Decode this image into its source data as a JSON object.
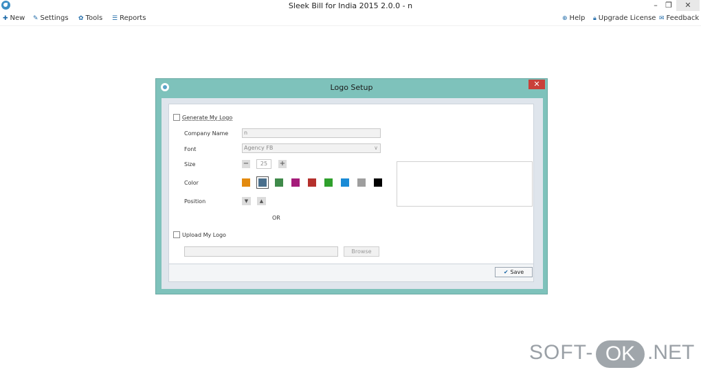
{
  "window": {
    "title": "Sleek Bill for India 2015 2.0.0 - n",
    "minimize_glyph": "–",
    "restore_glyph": "❐",
    "close_glyph": "✕"
  },
  "menubar": {
    "new": "New",
    "settings": "Settings",
    "tools": "Tools",
    "reports": "Reports",
    "help": "Help",
    "upgrade": "Upgrade License",
    "feedback": "Feedback",
    "icons": {
      "new": "plus-icon",
      "settings": "wrench-icon",
      "tools": "gear-icon",
      "reports": "list-icon",
      "help": "plus-circle-icon",
      "upgrade": "lock-icon",
      "feedback": "envelope-icon"
    }
  },
  "dialog": {
    "title": "Logo Setup",
    "close_glyph": "✕",
    "generate_label": "Generate My Logo",
    "company_name_label": "Company Name",
    "company_name_value": "n",
    "font_label": "Font",
    "font_value": "Agency FB",
    "size_label": "Size",
    "size_value": "25",
    "color_label": "Color",
    "colors": [
      "#e38a0e",
      "#4a6f8c",
      "#3f8a4a",
      "#a41c7a",
      "#b5302c",
      "#2fa02c",
      "#1a8bd6",
      "#9e9e9e",
      "#000000"
    ],
    "selected_color_index": 1,
    "position_label": "Position",
    "or_label": "OR",
    "upload_label": "Upload My Logo",
    "upload_value": "",
    "browse_label": "Browse",
    "save_label": "Save"
  },
  "watermark": {
    "left": "SOFT-",
    "middle": "OK",
    "right": ".NET"
  }
}
